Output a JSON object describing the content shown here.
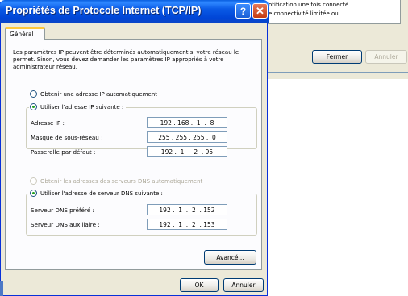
{
  "dialog": {
    "title": "Propriétés de Protocole Internet (TCP/IP)",
    "help_glyph": "?",
    "close_glyph": "✕",
    "tab_label": "Général",
    "intro": "Les paramètres IP peuvent être déterminés automatiquement si votre réseau le permet. Sinon, vous devez demander les paramètres IP appropriés à votre administrateur réseau.",
    "radio_auto_ip": "Obtenir une adresse IP automatiquement",
    "radio_manual_ip": "Utiliser l'adresse IP suivante :",
    "ip_label": "Adresse IP :",
    "ip_value": "192 . 168 .  1  .  8",
    "mask_label": "Masque de sous-réseau :",
    "mask_value": "255 . 255 . 255 .  0",
    "gateway_label": "Passerelle par défaut :",
    "gateway_value": "192 .  1  .  2  . 95",
    "radio_auto_dns": "Obtenir les adresses des serveurs DNS automatiquement",
    "radio_manual_dns": "Utiliser l'adresse de serveur DNS suivante :",
    "dns1_label": "Serveur DNS préféré :",
    "dns1_value": "192 .  1  .  2  . 152",
    "dns2_label": "Serveur DNS auxiliaire :",
    "dns2_value": "192 .  1  .  2  . 153",
    "advanced_label": "Avancé...",
    "ok_label": "OK",
    "cancel_label": "Annuler"
  },
  "background_window": {
    "line1": "otification une fois connecté",
    "line2": "e connectivité limitée ou",
    "close_label": "Fermer",
    "cancel_label": "Annuler"
  },
  "colors": {
    "titlebar": "#0a5ae6",
    "dialog_face": "#ece9d8",
    "close_button": "#c43a12",
    "radio_dot": "#21a121"
  }
}
